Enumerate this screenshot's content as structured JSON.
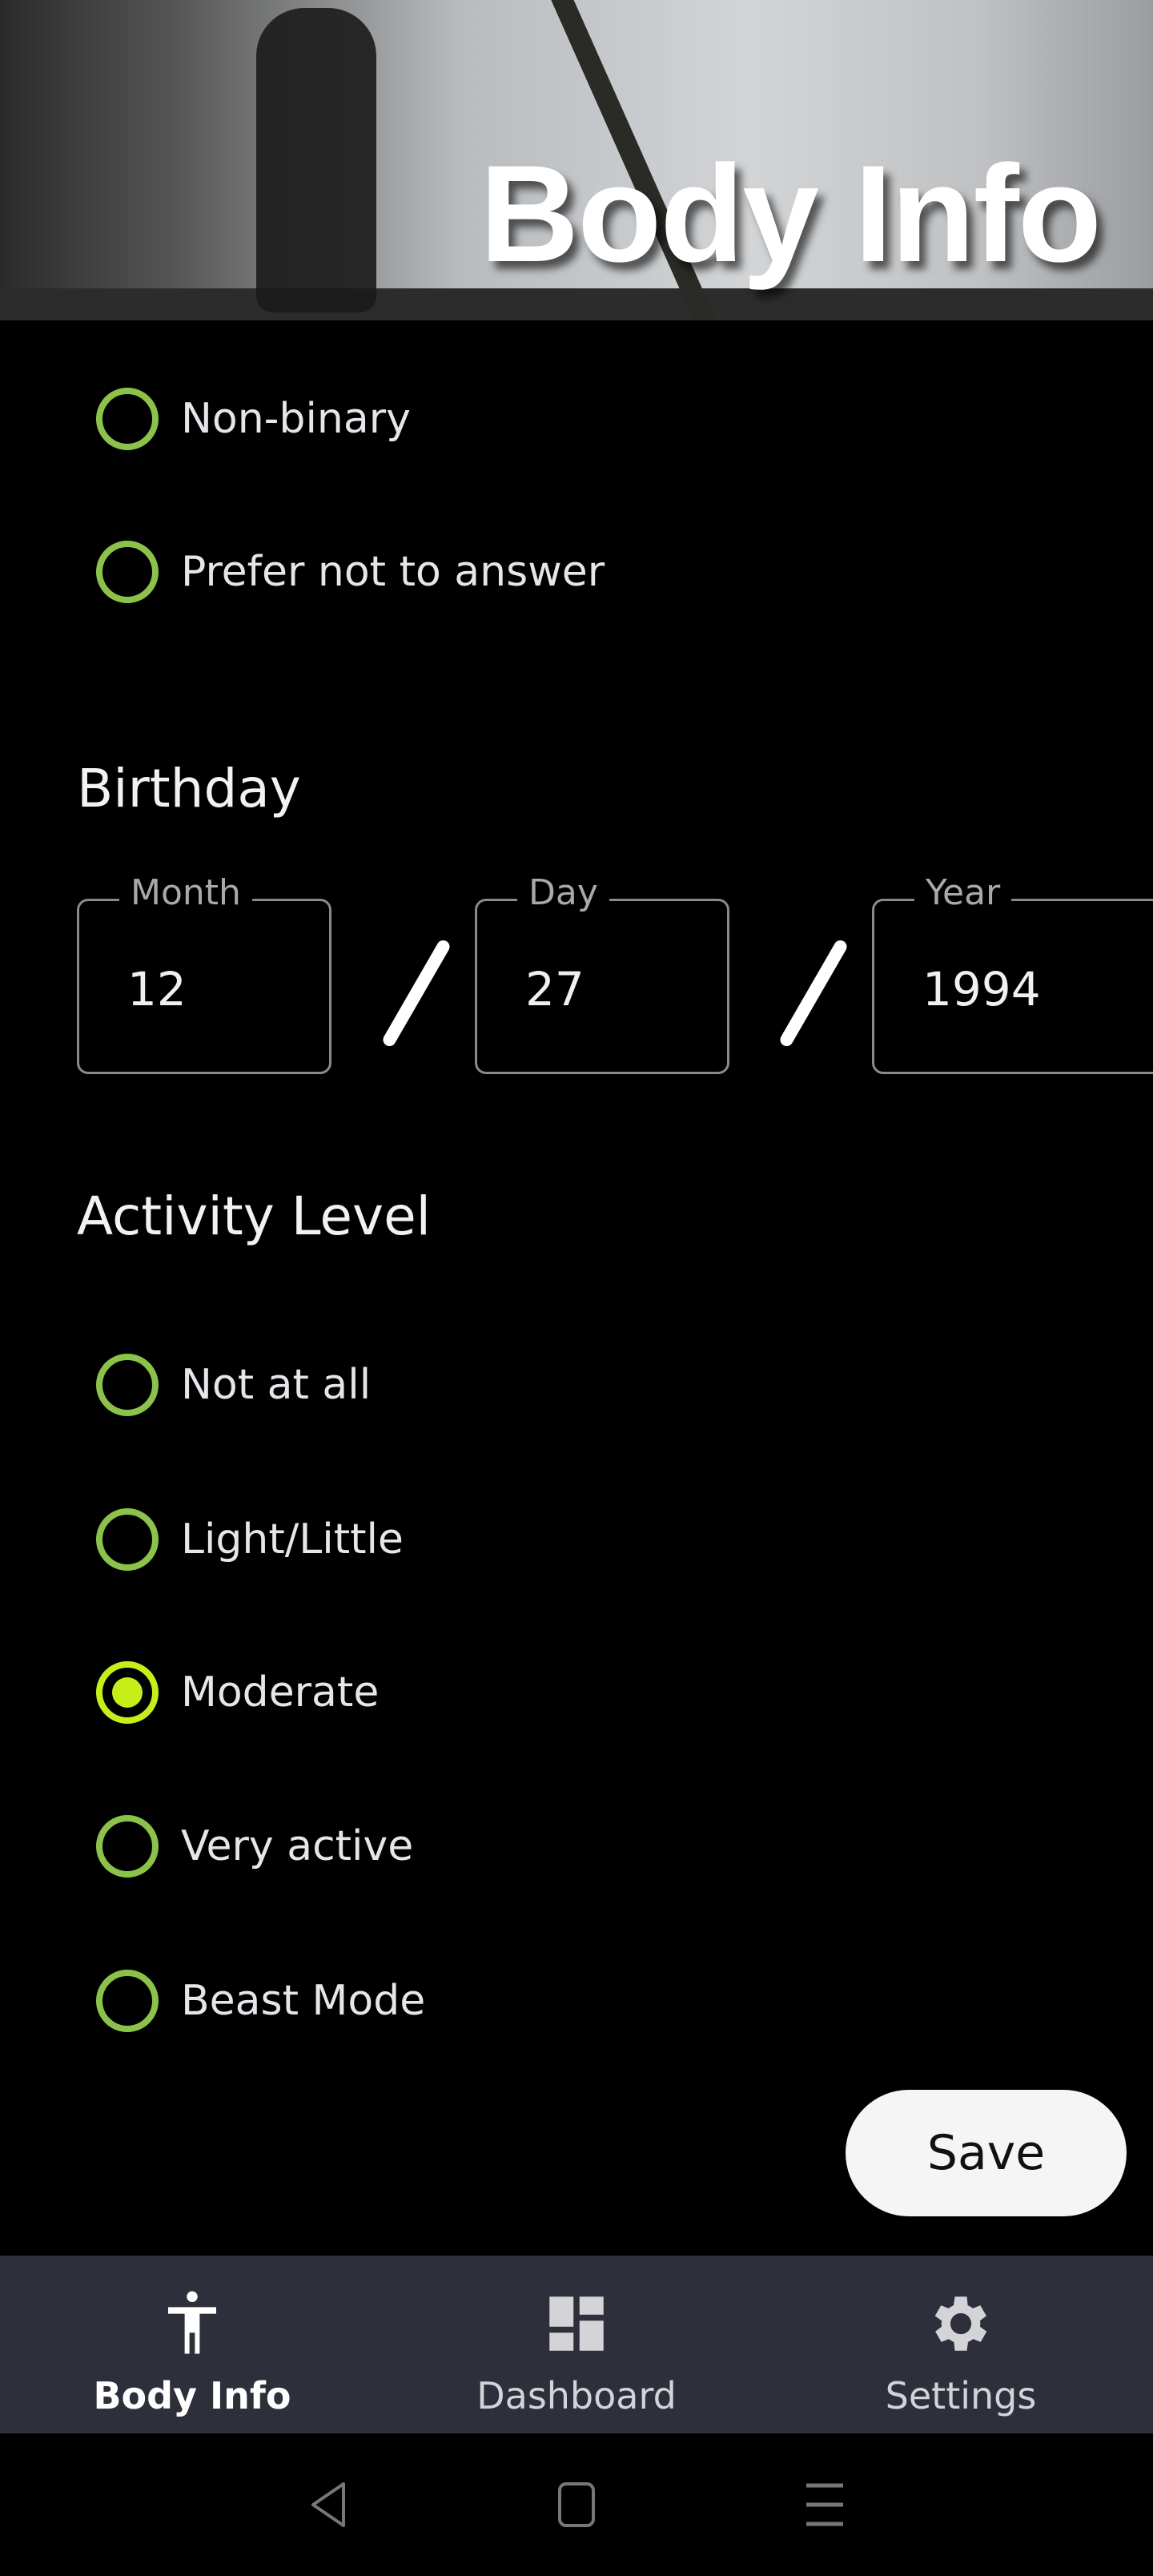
{
  "header": {
    "title": "Body Info"
  },
  "gender": {
    "options": [
      {
        "label": "Non-binary",
        "selected": false
      },
      {
        "label": "Prefer not to answer",
        "selected": false
      }
    ]
  },
  "birthday": {
    "heading": "Birthday",
    "month": {
      "label": "Month",
      "value": "12"
    },
    "day": {
      "label": "Day",
      "value": "27"
    },
    "year": {
      "label": "Year",
      "value": "1994"
    }
  },
  "activity": {
    "heading": "Activity Level",
    "options": [
      {
        "label": "Not at all",
        "selected": false
      },
      {
        "label": "Light/Little",
        "selected": false
      },
      {
        "label": "Moderate",
        "selected": true
      },
      {
        "label": "Very active",
        "selected": false
      },
      {
        "label": "Beast Mode",
        "selected": false
      }
    ]
  },
  "save_label": "Save",
  "nav": {
    "items": [
      {
        "label": "Body Info",
        "icon": "accessibility-icon",
        "active": true
      },
      {
        "label": "Dashboard",
        "icon": "dashboard-icon",
        "active": false
      },
      {
        "label": "Settings",
        "icon": "gear-icon",
        "active": false
      }
    ]
  },
  "colors": {
    "radio": "#8bc34a",
    "radio_selected": "#c6ef1a",
    "nav_bg": "#2d2f3a"
  }
}
